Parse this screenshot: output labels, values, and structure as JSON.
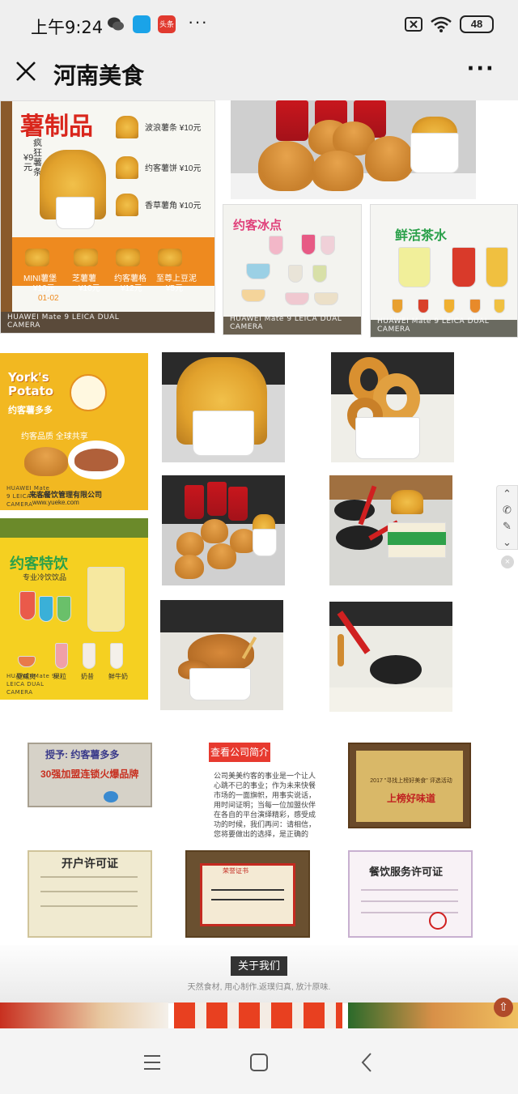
{
  "status_bar": {
    "time": "上午9:24",
    "app_icons": [
      "wechat-icon",
      "app-icon",
      "toutiao-icon"
    ],
    "toutiao_label": "头条",
    "more": "···",
    "battery": "48"
  },
  "title_bar": {
    "title": "河南美食",
    "more": "···"
  },
  "gallery": {
    "menu_fries": {
      "title": "薯制品",
      "side_text": "疯狂薯条",
      "price_badge": "¥9元",
      "items": [
        "波浪薯条 ¥10元",
        "约客薯饼 ¥10元",
        "香草薯角 ¥10元"
      ],
      "bottom_items": [
        "MINI薯堡",
        "芝薯薯",
        "约客薯格",
        "至尊上豆泥"
      ],
      "bottom_prices": [
        "¥10元",
        "¥10元",
        "¥12元",
        "¥5元"
      ],
      "page_no": "01-02",
      "watermark": "HUAWEI Mate 9 LEICA DUAL CAMERA"
    },
    "menu_ice": {
      "title": "约客冰点",
      "watermark": "HUAWEI Mate 9 LEICA DUAL CAMERA"
    },
    "menu_tea": {
      "title": "鲜活茶水",
      "watermark": "HUAWEI Mate 9 LEICA DUAL CAMERA"
    },
    "menu_potato": {
      "title": "York's Potato",
      "subtitle": "约客薯多多",
      "slogan": "约客品质 全球共享",
      "company": "来客餐饮管理有限公司",
      "website": "www.yueke.com",
      "watermark": "HUAWEI Mate 9 LEICA DUAL CAMERA"
    },
    "menu_drinks": {
      "title": "约客特饮",
      "subtitle": "专业冷饮饮品",
      "items": [
        "夏威夷",
        "果粒",
        "奶昔",
        "鲜牛奶"
      ],
      "watermark": "HUAWEI Mate 9 LEICA DUAL CAMERA"
    }
  },
  "certificates": {
    "plaque1_title": "授予: 约客薯多多",
    "plaque1_text": "30强加盟连锁火爆品牌",
    "intro_button": "查看公司简介",
    "intro_text": "公司美美约客的事业是一个让人心跳不已的事业；作为未来快餐市场的一面旗帜，用事实说话，用时间证明；当每一位加盟伙伴在各自的平台演绎精彩，感受成功的时候，我们再问：请相信，您将要做出的选择，是正确的",
    "plaque2_title": "2017 \"寻找上榜好美食\" 评选活动",
    "plaque2_text": "上榜好味道",
    "license1_title": "开户许可证",
    "license2_title": "荣誉证书",
    "license3_title": "餐饮服务许可证"
  },
  "about": {
    "button": "关于我们",
    "subtitle": "天然食材, 用心制作.返璞归真, 放汁原味."
  },
  "float_bar": {
    "up": "⌃",
    "phone": "✆",
    "edit": "✎",
    "down": "⌄",
    "close": "×",
    "top": "⇧"
  },
  "colors": {
    "accent_red": "#e73a2f",
    "brand_orange": "#ee8a1f",
    "brand_yellow": "#f5c518"
  }
}
